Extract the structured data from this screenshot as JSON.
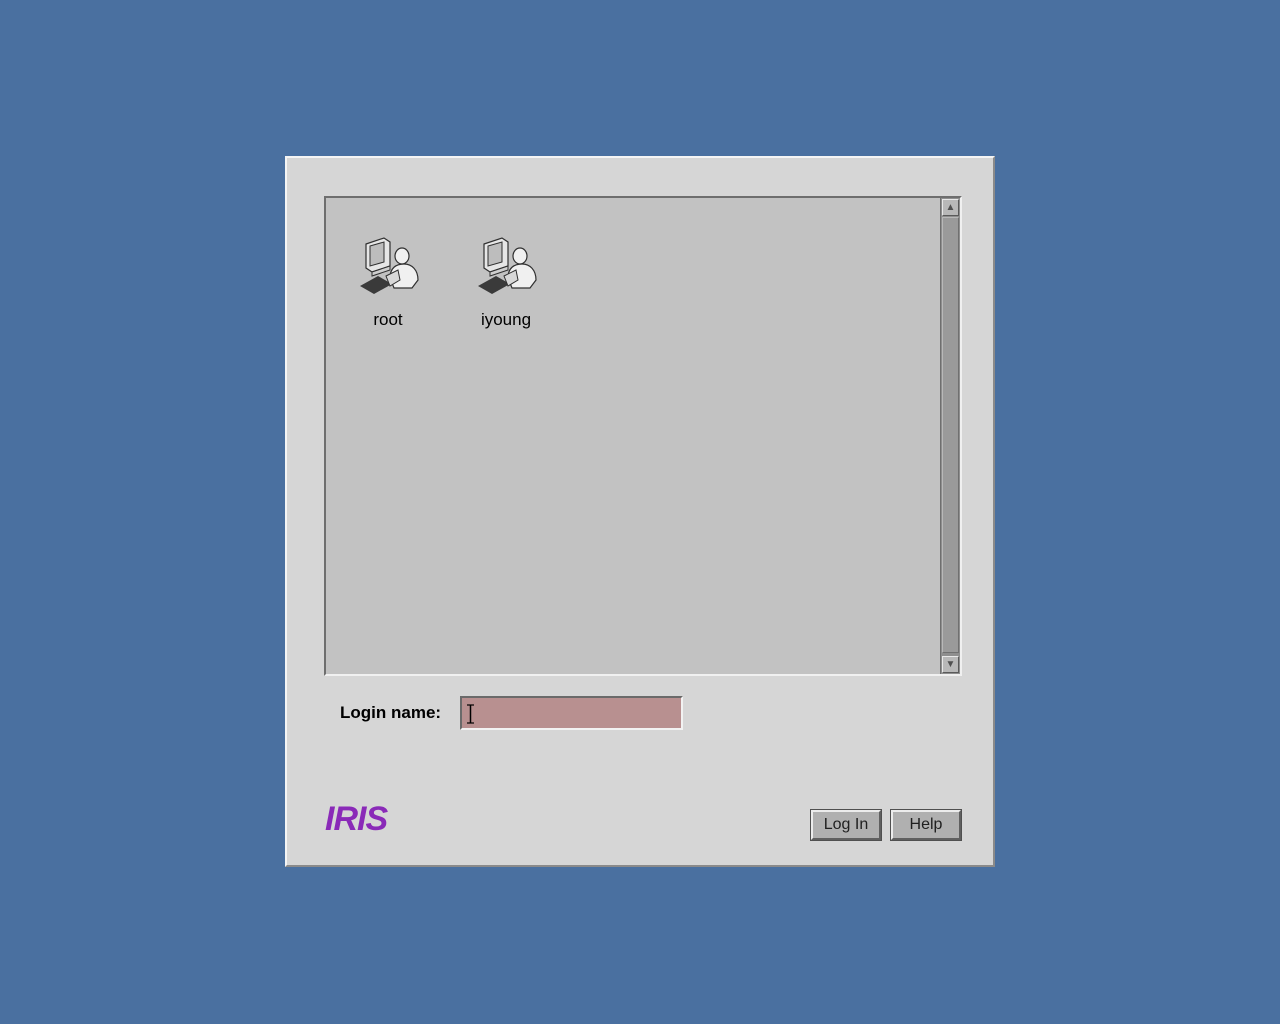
{
  "users": [
    {
      "name": "root",
      "icon": "user-workstation-icon"
    },
    {
      "name": "iyoung",
      "icon": "user-workstation-icon"
    }
  ],
  "login": {
    "label": "Login name:",
    "value": ""
  },
  "branding": {
    "logo_text": "IRIS",
    "logo_color": "#8a2ab8"
  },
  "buttons": {
    "login_label": "Log In",
    "help_label": "Help"
  },
  "colors": {
    "desktop": "#4a70a0",
    "dialog": "#d6d6d6",
    "field": "#b89090"
  }
}
